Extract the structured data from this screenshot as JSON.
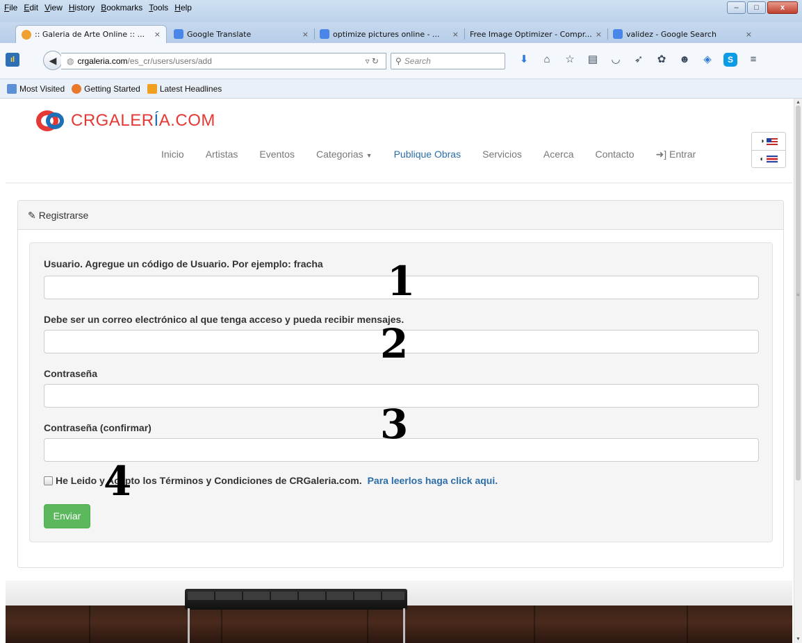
{
  "browser": {
    "menu": [
      "File",
      "Edit",
      "View",
      "History",
      "Bookmarks",
      "Tools",
      "Help"
    ],
    "tabs": [
      {
        "label": ":: Galeria de Arte Online :: ...",
        "active": true,
        "favicon_color": "#f0a030"
      },
      {
        "label": "Google Translate",
        "active": false,
        "favicon_color": "#4a86e8"
      },
      {
        "label": "optimize pictures online - ...",
        "active": false,
        "favicon_color": "#4a86e8"
      },
      {
        "label": "Free Image Optimizer - Compr...",
        "active": false,
        "favicon_color": ""
      },
      {
        "label": "validez - Google Search",
        "active": false,
        "favicon_color": "#4a86e8"
      }
    ],
    "tab_close": "×",
    "new_tab": "+",
    "url_host": "crgaleria.com",
    "url_path": "/es_cr/users/users/add",
    "search_placeholder": "Search",
    "bookmarks": [
      {
        "label": "Most Visited",
        "color": "#5b8fd6"
      },
      {
        "label": "Getting Started",
        "color": "#e8782a"
      },
      {
        "label": "Latest Headlines",
        "color": "#f0a020"
      }
    ]
  },
  "site": {
    "logo_prefix": "CRGALER",
    "logo_accent": "Í",
    "logo_suffix": "A.COM",
    "nav": [
      "Inicio",
      "Artistas",
      "Eventos",
      "Categorias",
      "Publique Obras",
      "Servicios",
      "Acerca",
      "Contacto",
      "Entrar"
    ],
    "nav_highlight_index": 4,
    "brand_red": "#e53935",
    "brand_blue": "#1e6fb5"
  },
  "form": {
    "heading": "Registrarse",
    "fields": [
      {
        "label": "Usuario. Agregue un código de Usuario. Por ejemplo: fracha",
        "value": ""
      },
      {
        "label": "Debe ser un correo electrónico al que tenga acceso y pueda recibir mensajes.",
        "value": ""
      },
      {
        "label": "Contraseña",
        "value": ""
      },
      {
        "label": "Contraseña (confirmar)",
        "value": ""
      }
    ],
    "terms_text": "He Leido y Acepto los Términos y Condiciones de CRGaleria.com.",
    "terms_link": "Para leerlos haga click aqui.",
    "submit": "Enviar",
    "submit_color": "#5cb85c",
    "annotations": [
      "1",
      "2",
      "3",
      "4"
    ]
  }
}
